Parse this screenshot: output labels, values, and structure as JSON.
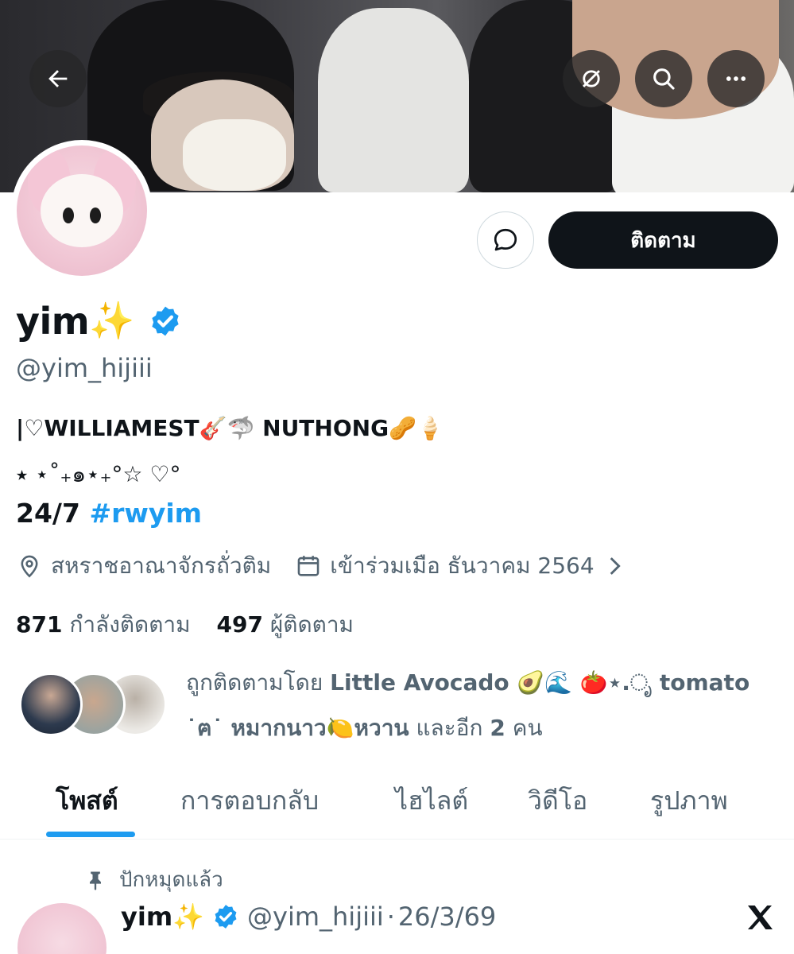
{
  "profile": {
    "name": "yim",
    "name_emoji": "✨",
    "handle": "@yim_hijiii",
    "bio_line1": "|♡WILLIAMEST🎸🦈 NUTHONG🥜🍦",
    "bio_line2": "⭑ ⋆˚₊๑⋆₊°☆ ♡°",
    "bio_line3_prefix": "24/7",
    "bio_line3_hashtag": "#rwyim",
    "location": "สหราชอาณาจักรถั่วติม",
    "joined": "เข้าร่วมเมือ ธันวาคม 2564",
    "following_count": "871",
    "following_label": "กำลังติดตาม",
    "followers_count": "497",
    "followers_label": "ผู้ติดตาม",
    "followed_by_prefix": "ถูกติดตามโดย",
    "followed_by_names": "Little Avocado 🥑🌊 🍅⋆.ೃ tomato ˙ฅ˙ หมากนาว🍋หวาน",
    "followed_by_suffix_and": "และอีก",
    "followed_by_count": "2",
    "followed_by_suffix_unit": "คน"
  },
  "actions": {
    "follow_label": "ติดตาม"
  },
  "tabs": [
    {
      "label": "โพสต์",
      "active": true
    },
    {
      "label": "การตอบกลับ",
      "active": false
    },
    {
      "label": "ไฮไลต์",
      "active": false
    },
    {
      "label": "วิดีโอ",
      "active": false
    },
    {
      "label": "รูปภาพ",
      "active": false
    }
  ],
  "pinned_post": {
    "pinned_label": "ปักหมุดแล้ว",
    "author_name": "yim",
    "author_emoji": "✨",
    "author_handle": "@yim_hijiii",
    "separator": "·",
    "date": "26/3/69"
  },
  "icons": {
    "back": "arrow-left-icon",
    "grok": "grok-icon",
    "search": "search-icon",
    "more": "more-icon",
    "message": "message-icon",
    "verified": "verified-badge-icon",
    "location": "location-icon",
    "calendar": "calendar-icon",
    "chevron": "chevron-right-icon",
    "pin": "pin-icon",
    "x_logo": "x-logo-icon"
  },
  "colors": {
    "accent": "#1d9bf0",
    "text_primary": "#0f1419",
    "text_secondary": "#536471",
    "button_dark": "#0f1419"
  }
}
